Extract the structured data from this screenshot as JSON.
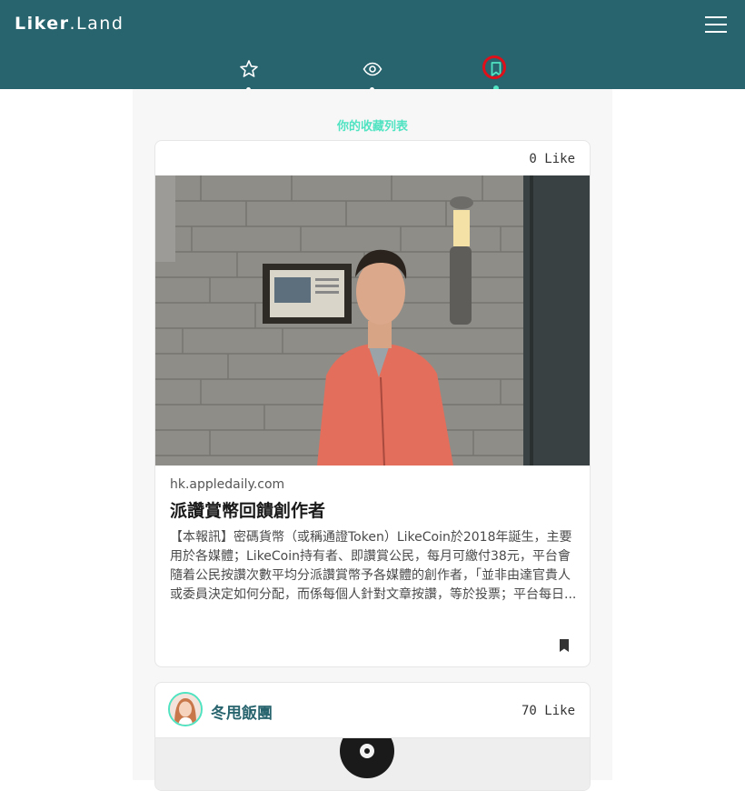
{
  "header": {
    "logo_text_bold": "Liker",
    "logo_text_light": ".Land",
    "menu_icon": "hamburger-menu-icon",
    "tabs": [
      {
        "icon": "star-icon",
        "active": false
      },
      {
        "icon": "eye-icon",
        "active": false
      },
      {
        "icon": "bookmark-icon",
        "active": true
      }
    ],
    "colors": {
      "bar": "#28646e",
      "accent": "#50e3c2",
      "highlight": "#e0101a"
    }
  },
  "main": {
    "heading": "你的收藏列表",
    "cards": [
      {
        "likes": "0",
        "like_unit": "Like",
        "domain": "hk.appledaily.com",
        "title": "派讚賞幣回饋創作者",
        "description": "【本報訊】密碼貨幣（或稱通證Token）LikeCoin於2018年誕生，主要用於各媒體；LikeCoin持有者、即讚賞公民，每月可繳付38元，平台會隨着公民按讚次數平均分派讚賞幣予各媒體的創作者，「並非由達官貴人或委員決定如何分配，而係每個人針對文章按讚，等於投票；平台每日...",
        "image": "man-in-red-jacket-photo",
        "action_icon": "bookmark-filled-icon"
      },
      {
        "author": "冬甩飯團",
        "likes": "70",
        "like_unit": "Like",
        "avatar": "author-avatar"
      }
    ]
  }
}
